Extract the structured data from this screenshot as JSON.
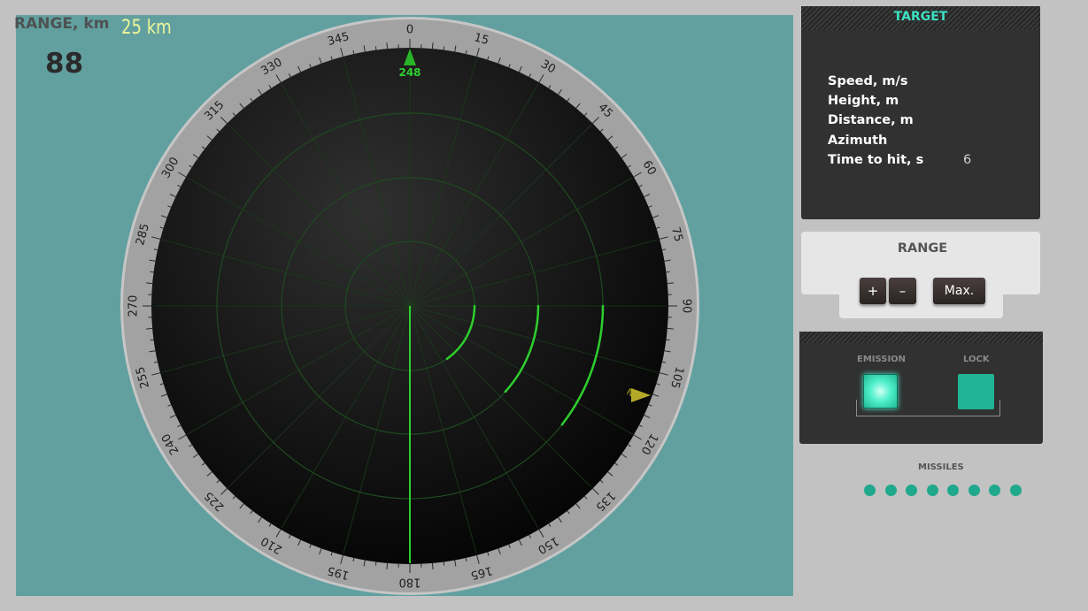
{
  "range_display": {
    "caption": "RANGE, km",
    "value": "25 km",
    "counter": "88"
  },
  "radar": {
    "heading_marker_value": "248",
    "compass_labels": [
      "0",
      "15",
      "30",
      "45",
      "60",
      "75",
      "90",
      "105",
      "120",
      "135",
      "150",
      "165",
      "180",
      "195",
      "210",
      "225",
      "240",
      "255",
      "270",
      "285",
      "300",
      "315",
      "330",
      "345"
    ],
    "target_marker_label": "N",
    "colors": {
      "scope_bg": "#62a0a0",
      "screen": "#0c0c0c",
      "bezel": "#a2a2a2",
      "sweep": "#2dcf2d",
      "grid": "#1f4a1f",
      "marker": "#b6a92a"
    }
  },
  "target": {
    "title": "TARGET",
    "rows": [
      {
        "label": "Speed, m/s",
        "value": ""
      },
      {
        "label": "Height, m",
        "value": ""
      },
      {
        "label": "Distance, m",
        "value": ""
      },
      {
        "label": "Azimuth",
        "value": ""
      },
      {
        "label": "Time to hit, s",
        "value": "6"
      }
    ]
  },
  "range_controls": {
    "title": "RANGE",
    "plus": "+",
    "minus": "–",
    "max": "Max."
  },
  "controls": {
    "emission_label": "EMISSION",
    "lock_label": "LOCK"
  },
  "missiles": {
    "label": "MISSILES",
    "count": 8
  }
}
